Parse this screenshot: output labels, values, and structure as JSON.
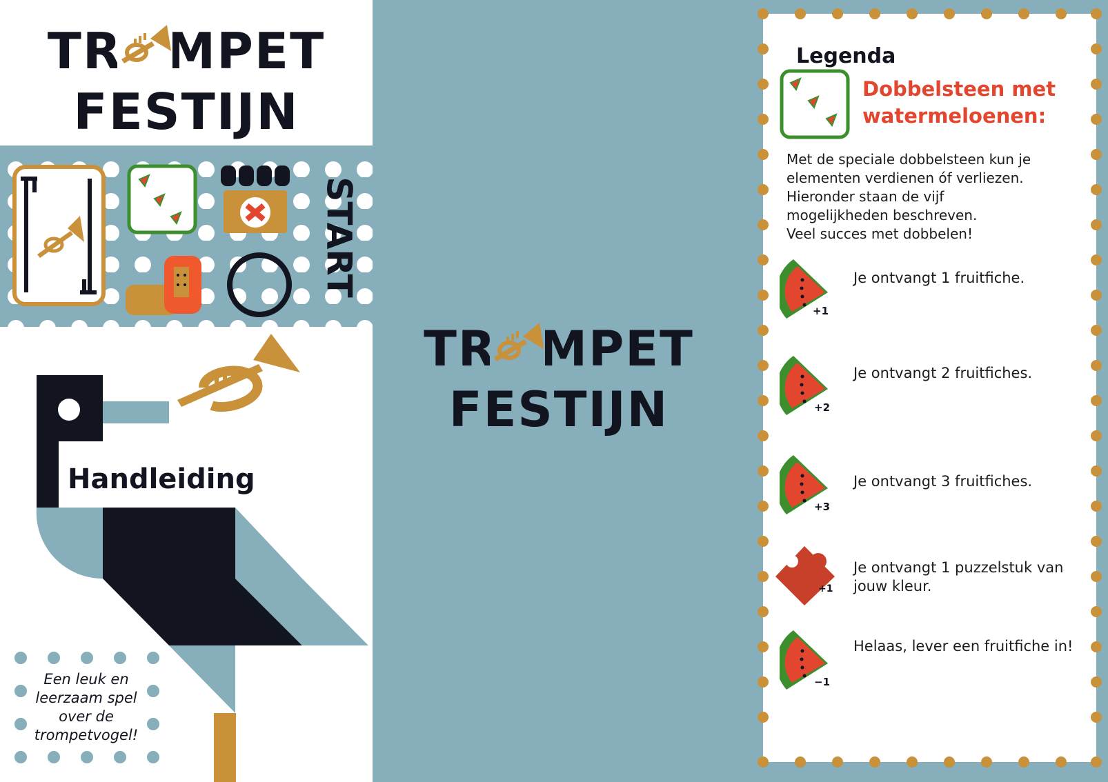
{
  "brand": {
    "title_line1": "TROMPET",
    "title_line2": "FESTIJN",
    "colors": {
      "navy": "#121420",
      "gold": "#c8913a",
      "blue_gray": "#87aebb",
      "red": "#e2462e",
      "green": "#3d8f2e"
    }
  },
  "left_panel": {
    "board_start_label": "START",
    "manual_title": "Handleiding",
    "tagline_lines": [
      "Een leuk en",
      "leerzaam spel",
      "over de",
      "trompetvogel!"
    ]
  },
  "legend": {
    "title": "Legenda",
    "dice_title_line1": "Dobbelsteen met",
    "dice_title_line2": "watermeloenen:",
    "intro_lines": [
      "Met de speciale dobbelsteen kun je",
      "elementen verdienen óf verliezen.",
      "Hieronder staan de vijf",
      "mogelijkheden beschreven.",
      "Veel succes met dobbelen!"
    ],
    "items": [
      {
        "icon": "watermelon-icon",
        "badge": "+1",
        "text_lines": [
          "Je ontvangt 1 fruitfiche."
        ]
      },
      {
        "icon": "watermelon-icon",
        "badge": "+2",
        "text_lines": [
          "Je ontvangt 2 fruitfiches."
        ]
      },
      {
        "icon": "watermelon-icon",
        "badge": "+3",
        "text_lines": [
          "Je ontvangt 3 fruitfiches."
        ]
      },
      {
        "icon": "puzzle-piece-icon",
        "badge": "+1",
        "text_lines": [
          "Je ontvangt 1 puzzelstuk van",
          "jouw kleur."
        ]
      },
      {
        "icon": "watermelon-icon",
        "badge": "−1",
        "text_lines": [
          "Helaas, lever een fruitfiche in!"
        ]
      }
    ]
  }
}
